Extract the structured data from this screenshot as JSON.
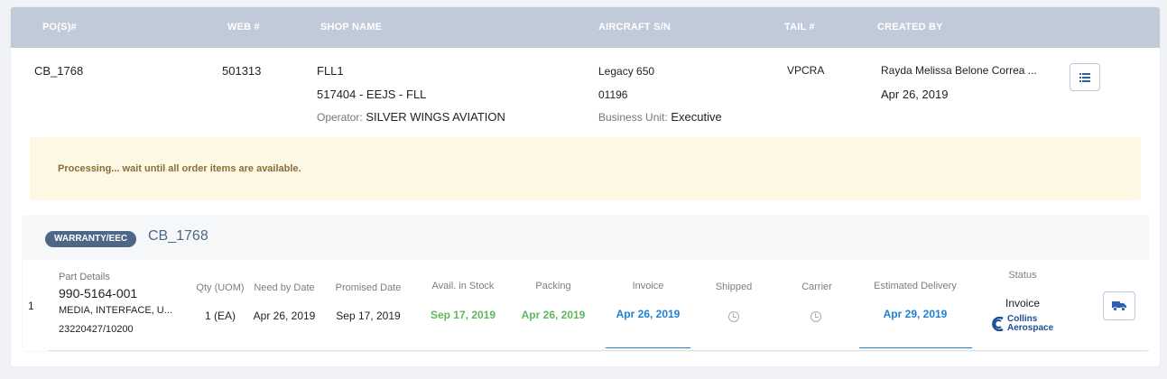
{
  "header": {
    "pos": "PO(S)#",
    "web": "WEB #",
    "shop": "SHOP NAME",
    "aircraft": "AIRCRAFT S/N",
    "tail": "TAIL #",
    "created": "CREATED BY"
  },
  "order": {
    "po": "CB_1768",
    "web": "501313",
    "shop_name": "FLL1",
    "shop_code": "517404 - EEJS - FLL",
    "operator_label": "Operator:",
    "operator_value": "SILVER WINGS AVIATION",
    "aircraft_model": "Legacy 650",
    "aircraft_sn": "01196",
    "business_unit_label": "Business Unit:",
    "business_unit_value": "Executive",
    "tail": "VPCRA",
    "created_by": "Rayda Melissa Belone Correa ...",
    "created_date": "Apr 26, 2019",
    "details_icon": "list-icon"
  },
  "alert": {
    "message": "Processing... wait until all order items are available."
  },
  "suborder": {
    "badge": "WARRANTY/EEC",
    "id": "CB_1768"
  },
  "item_columns": {
    "part_details": "Part Details",
    "qty": "Qty (UOM)",
    "need_by": "Need by Date",
    "promised": "Promised Date",
    "avail": "Avail. in Stock",
    "packing": "Packing",
    "invoice": "Invoice",
    "shipped": "Shipped",
    "carrier": "Carrier",
    "est_delivery": "Estimated Delivery",
    "status": "Status"
  },
  "item": {
    "index": "1",
    "part_number": "990-5164-001",
    "description": "MEDIA, INTERFACE, U...",
    "ref": "23220427/10200",
    "qty": "1 (EA)",
    "need_by": "Apr 26, 2019",
    "promised": "Sep 17, 2019",
    "avail": "Sep 17, 2019",
    "packing": "Apr 26, 2019",
    "invoice": "Apr 26, 2019",
    "est_delivery": "Apr 29, 2019",
    "status": "Invoice",
    "logo_line1": "Collins",
    "logo_line2": "Aerospace",
    "shipped_icon": "clock-icon",
    "carrier_icon": "clock-icon",
    "action_icon": "truck-icon"
  },
  "colors": {
    "header_bg": "#c1cad9",
    "alert_bg": "#fcf8e3",
    "alert_text": "#8a6d3b",
    "badge_bg": "#4f6787",
    "green": "#5cb85c",
    "blue": "#1f7fd0",
    "logo_blue": "#1f4e96"
  }
}
